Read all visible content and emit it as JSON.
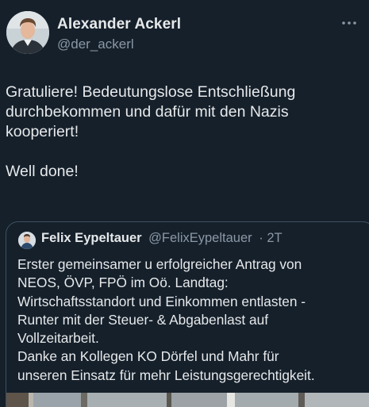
{
  "tweet": {
    "author": {
      "name": "Alexander Ackerl",
      "handle": "@der_ackerl",
      "avatar_icon": "profile-photo"
    },
    "more_icon": "more-dots-icon",
    "text_lines": [
      "Gratuliere! Bedeutungslose Entschließung",
      "durchbekommen und dafür mit den Nazis",
      "kooperiert!"
    ],
    "text_closing": "Well done!"
  },
  "quote": {
    "author": {
      "name": "Felix Eypeltauer",
      "handle": "@FelixEypeltauer",
      "time": "· 2T",
      "avatar_icon": "profile-photo"
    },
    "text_lines": [
      "Erster gemeinsamer u erfolgreicher Antrag von",
      "NEOS, ÖVP, FPÖ im Oö. Landtag:",
      "Wirtschaftsstandort und Einkommen entlasten -",
      "Runter mit der Steuer- & Abgabenlast auf",
      "Vollzeitarbeit.",
      "Danke an Kollegen KO Dörfel und Mahr für",
      "unseren Einsatz für mehr Leistungsgerechtigkeit."
    ]
  },
  "colors": {
    "background": "#15202b",
    "text": "#e7e9ea",
    "secondary_text": "#8b98a5",
    "border": "#3f4f5f"
  }
}
